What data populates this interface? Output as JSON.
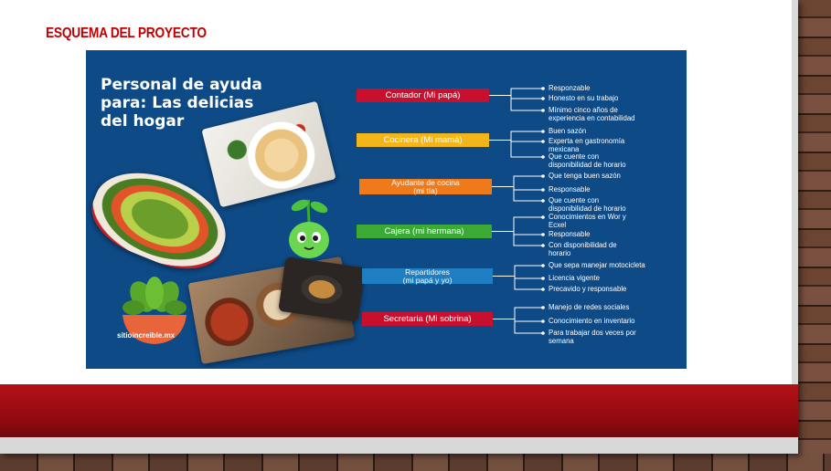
{
  "slide": {
    "title": "ESQUEMA DEL PROYECTO"
  },
  "panel": {
    "heading_lines": [
      "Personal de ayuda",
      "para: Las delicias",
      "del hogar"
    ],
    "logo_text": "sitioincreible.mx"
  },
  "org_chart": [
    {
      "role_lines": [
        "Contador (Mi papá)"
      ],
      "color": "#c8102e",
      "requirements": [
        [
          "Responzable"
        ],
        [
          "Honesto en su trabajo"
        ],
        [
          "Mínimo cinco años de",
          "experiencia en contabilidad"
        ]
      ]
    },
    {
      "role_lines": [
        "Cocinera (Mi mamá)"
      ],
      "color": "#f2b61a",
      "requirements": [
        [
          "Buen sazón"
        ],
        [
          "Experta en gastronomía",
          "mexicana"
        ],
        [
          "Que cuente con",
          "disponibilidad de horario"
        ]
      ]
    },
    {
      "role_lines": [
        "Ayudante de cocina",
        "(mi tía)"
      ],
      "color": "#f07a1a",
      "requirements": [
        [
          "Que tenga buen sazón"
        ],
        [
          "Responsable"
        ],
        [
          "Que cuente con",
          "disponibilidad de horario"
        ]
      ]
    },
    {
      "role_lines": [
        "Cajera (mi hermana)"
      ],
      "color": "#3aaa35",
      "requirements": [
        [
          "Conocimientos en Wor y",
          "Ecxel"
        ],
        [
          "Responsable"
        ],
        [
          "Con disponibilidad de",
          "horario"
        ]
      ]
    },
    {
      "role_lines": [
        "Repartidores",
        "(mi papá y yo)"
      ],
      "color": "#1f7ec1",
      "requirements": [
        [
          "Que sepa manejar motocicleta"
        ],
        [
          "Licencia vigente"
        ],
        [
          "Precavido y responsable"
        ]
      ]
    },
    {
      "role_lines": [
        "Secretaria (Mi sobrina)"
      ],
      "color": "#c8102e",
      "requirements": [
        [
          "Manejo de redes sociales"
        ],
        [
          "Conocimiento en inventario"
        ],
        [
          "Para trabajar dos veces por",
          "semana"
        ]
      ]
    }
  ],
  "colors": {
    "slide_title": "#c00000",
    "panel_bg": "#0e4a86",
    "red_band": "#b31217"
  }
}
